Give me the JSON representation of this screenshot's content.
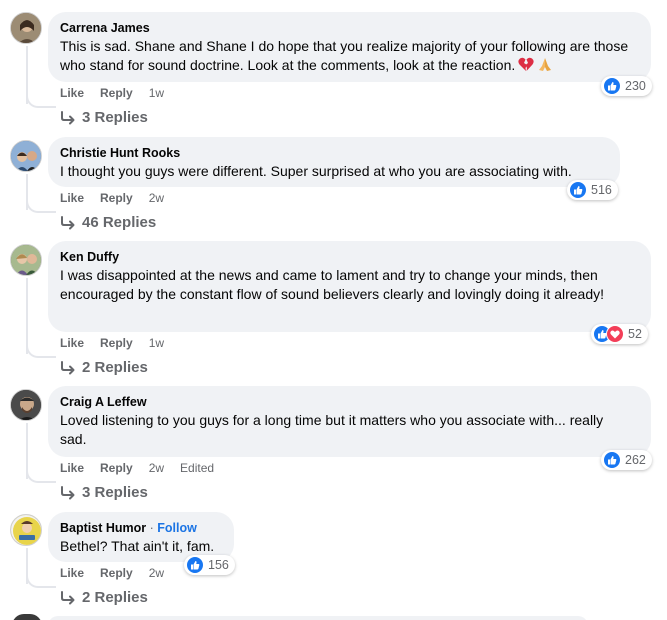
{
  "comments": [
    {
      "author": "Carrena James",
      "text": "This is sad. Shane and Shane I do hope that you realize majority of your following are those who stand for sound doctrine. Look at the comments, look at the reaction.",
      "emoji": [
        "broken-heart",
        "praying-hands"
      ],
      "like": "Like",
      "reply": "Reply",
      "time": "1w",
      "reaction_count": "230",
      "reactions": [
        "like"
      ],
      "replies": "3 Replies",
      "avatar_color": "#8a7b6a"
    },
    {
      "author": "Christie Hunt Rooks",
      "text": "I thought you guys were different. Super surprised at who you are associating with.",
      "like": "Like",
      "reply": "Reply",
      "time": "2w",
      "reaction_count": "516",
      "reactions": [
        "like"
      ],
      "replies": "46 Replies",
      "avatar_color": "#5b7fa8"
    },
    {
      "author": "Ken Duffy",
      "text": "I was disappointed at the news and came to lament and try to change your minds, then encouraged by the constant flow of sound believers clearly and lovingly doing it already!",
      "like": "Like",
      "reply": "Reply",
      "time": "1w",
      "reaction_count": "52",
      "reactions": [
        "like",
        "love"
      ],
      "replies": "2 Replies",
      "avatar_color": "#6f8a5c"
    },
    {
      "author": "Craig A Leffew",
      "text": "Loved listening to you guys for a long time but it matters who you associate with... really sad.",
      "like": "Like",
      "reply": "Reply",
      "time": "2w",
      "edited": "Edited",
      "reaction_count": "262",
      "reactions": [
        "like"
      ],
      "replies": "3 Replies",
      "avatar_color": "#3a3a3a"
    },
    {
      "author": "Baptist Humor",
      "follow": "Follow",
      "text": "Bethel? That ain't it, fam.",
      "like": "Like",
      "reply": "Reply",
      "time": "2w",
      "reaction_count": "156",
      "reactions": [
        "like"
      ],
      "replies": "2 Replies",
      "avatar_color": "#c9b63a"
    }
  ],
  "colors": {
    "bubble": "#f0f2f5",
    "meta_text": "#65676b",
    "like_blue": "#1877f2",
    "love_red": "#f33e58",
    "follow_blue": "#1b74e4"
  }
}
